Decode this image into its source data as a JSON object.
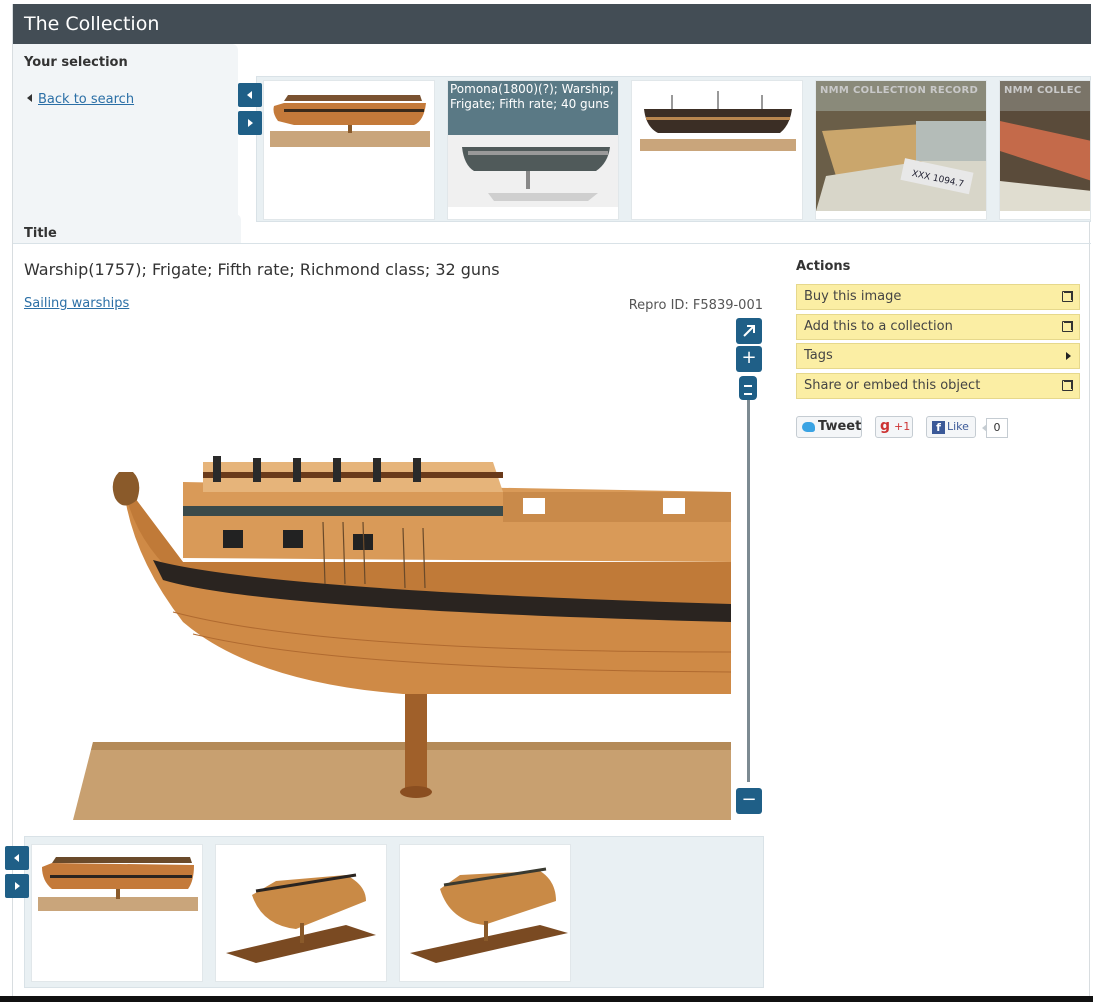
{
  "app": {
    "title": "The Collection"
  },
  "selection": {
    "tab_label": "Your selection",
    "back_label": "Back to search",
    "thumbnails": [
      {
        "kind": "ship-model"
      },
      {
        "kind": "ship-photo",
        "caption": "Pomona(1800)(?); Warship; Frigate; Fifth rate; 40 guns"
      },
      {
        "kind": "ship-model"
      },
      {
        "kind": "record-photo",
        "overlay": "NMM COLLECTION RECORD"
      },
      {
        "kind": "record-photo",
        "overlay": "NMM COLLEC"
      }
    ]
  },
  "object": {
    "section_label": "Title",
    "title": "Warship(1757); Frigate; Fifth rate; Richmond class; 32 guns",
    "category": "Sailing warships",
    "repro_id": "Repro ID: F5839-001"
  },
  "zoom": {
    "fullscreen_icon": "expand-icon",
    "zoom_in": "+",
    "zoom_out": "−",
    "level": 1.0
  },
  "actions": {
    "label": "Actions",
    "items": [
      {
        "label": "Buy this image",
        "icon": "external-link-icon"
      },
      {
        "label": "Add this to a collection",
        "icon": "external-link-icon"
      },
      {
        "label": "Tags",
        "icon": "caret-right-icon"
      },
      {
        "label": "Share or embed this object",
        "icon": "external-link-icon"
      }
    ]
  },
  "social": {
    "tweet": "Tweet",
    "gplus": "+1",
    "gplus_letter": "g",
    "fb_like": "Like",
    "fb_letter": "f",
    "fb_count": "0"
  },
  "colors": {
    "header": "#434d55",
    "nav": "#1f5f87",
    "action_bg": "#fbeea4",
    "link": "#2b6fa6"
  }
}
